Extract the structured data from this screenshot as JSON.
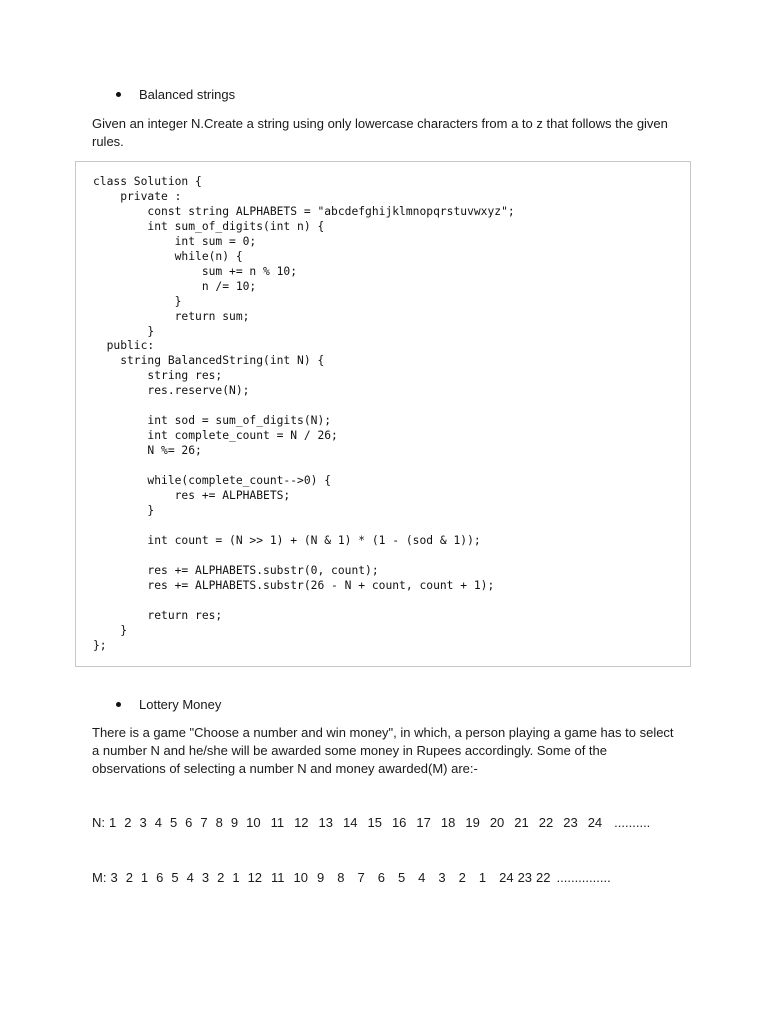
{
  "sections": [
    {
      "heading": "Balanced strings",
      "description": "Given an integer N.Create a string using only lowercase characters from a to z that follows the given rules.",
      "code": "class Solution {\n    private :\n        const string ALPHABETS = \"abcdefghijklmnopqrstuvwxyz\";\n        int sum_of_digits(int n) {\n            int sum = 0;\n            while(n) {\n                sum += n % 10;\n                n /= 10;\n            }\n            return sum;\n        }\n  public:\n    string BalancedString(int N) {\n        string res;\n        res.reserve(N);\n\n        int sod = sum_of_digits(N);\n        int complete_count = N / 26;\n        N %= 26;\n\n        while(complete_count-->0) {\n            res += ALPHABETS;\n        }\n\n        int count = (N >> 1) + (N & 1) * (1 - (sod & 1));\n\n        res += ALPHABETS.substr(0, count);\n        res += ALPHABETS.substr(26 - N + count, count + 1);\n\n        return res;\n    }\n};"
    },
    {
      "heading": "Lottery Money",
      "description": "There is a game \"Choose a number and win money\", in which, a person playing a game has to select a number N and he/she will be awarded some money in Rupees accordingly. Some of the observations of selecting a number N and money awarded(M) are:-"
    }
  ],
  "observations": {
    "n_label": "N:",
    "n_values": [
      "1",
      "2",
      "3",
      "4",
      "5",
      "6",
      "7",
      "8",
      "9",
      "10",
      "11",
      "12",
      "13",
      "14",
      "15",
      "16",
      "17",
      "18",
      "19",
      "20",
      "21",
      "22",
      "23",
      "24"
    ],
    "n_tail": "..........",
    "m_label": "M:",
    "m_values": [
      "3",
      "2",
      "1",
      "6",
      "5",
      "4",
      "3",
      "2",
      "1",
      "12",
      "11",
      "10",
      "9",
      "8",
      "7",
      "6",
      "5",
      "4",
      "3",
      "2",
      "1",
      "24",
      "23",
      "22"
    ],
    "m_tail": "..............."
  }
}
